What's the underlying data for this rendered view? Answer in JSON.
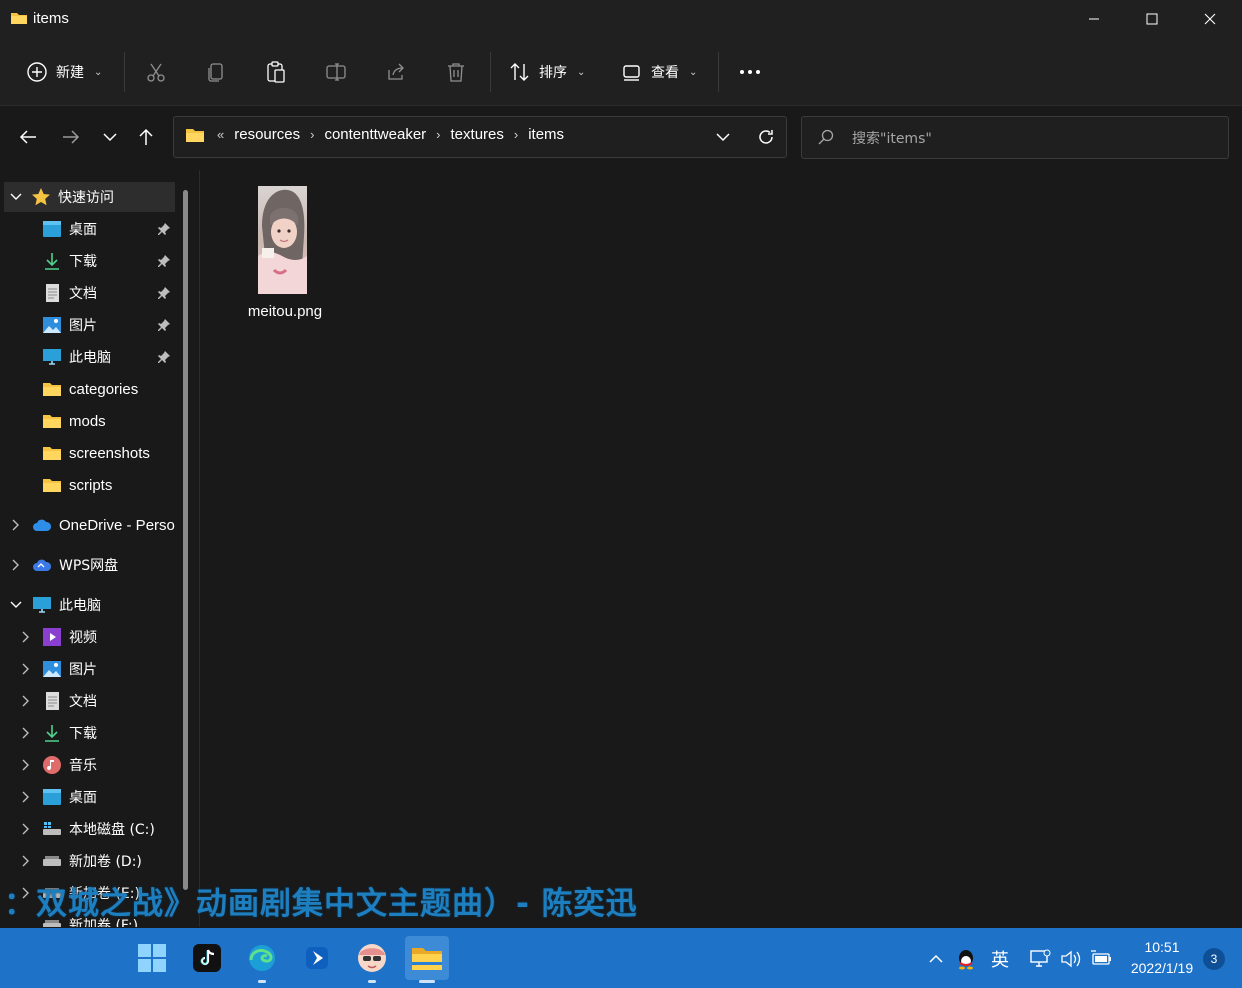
{
  "window": {
    "title": "items",
    "controls": [
      "minimize-icon",
      "maximize-icon",
      "close-icon"
    ]
  },
  "toolbar": {
    "new_label": "新建",
    "sort_label": "排序",
    "view_label": "查看",
    "icons": [
      "plus-circle-icon",
      "cut-icon",
      "copy-icon",
      "paste-icon",
      "rename-icon",
      "share-icon",
      "delete-icon",
      "sort-icon",
      "view-icon",
      "more-icon"
    ]
  },
  "address": {
    "overflow": "«",
    "crumbs": [
      "resources",
      "contenttweaker",
      "textures",
      "items"
    ]
  },
  "search": {
    "placeholder": "搜索\"items\""
  },
  "sidebar": {
    "quick_access": "快速访问",
    "quick_items": [
      "桌面",
      "下载",
      "文档",
      "图片",
      "此电脑",
      "categories",
      "mods",
      "screenshots",
      "scripts"
    ],
    "onedrive": "OneDrive - Perso",
    "wps": "WPS网盘",
    "this_pc": "此电脑",
    "pc_items": [
      "视频",
      "图片",
      "文档",
      "下载",
      "音乐",
      "桌面",
      "本地磁盘 (C:)",
      "新加卷 (D:)",
      "新加卷 (E:)",
      "新加卷 (F:)"
    ]
  },
  "content": {
    "files": [
      {
        "name": "meitou.png",
        "type": "image"
      }
    ]
  },
  "overlay": {
    "lyrics": "：双城之战》动画剧集中文主题曲）- 陈奕迅"
  },
  "taskbar": {
    "apps": [
      "windows-start-icon",
      "tiktok-icon",
      "edge-icon",
      "arrow-app-icon",
      "avatar-app-icon",
      "file-explorer-icon"
    ],
    "ime": "英",
    "time": "10:51",
    "date": "2022/1/19",
    "notifications": "3"
  },
  "colors": {
    "background": "#191919",
    "chrome": "#202020",
    "taskbar": "#1e73c9",
    "folder": "#f4c342",
    "accent": "#4cc2ff"
  }
}
